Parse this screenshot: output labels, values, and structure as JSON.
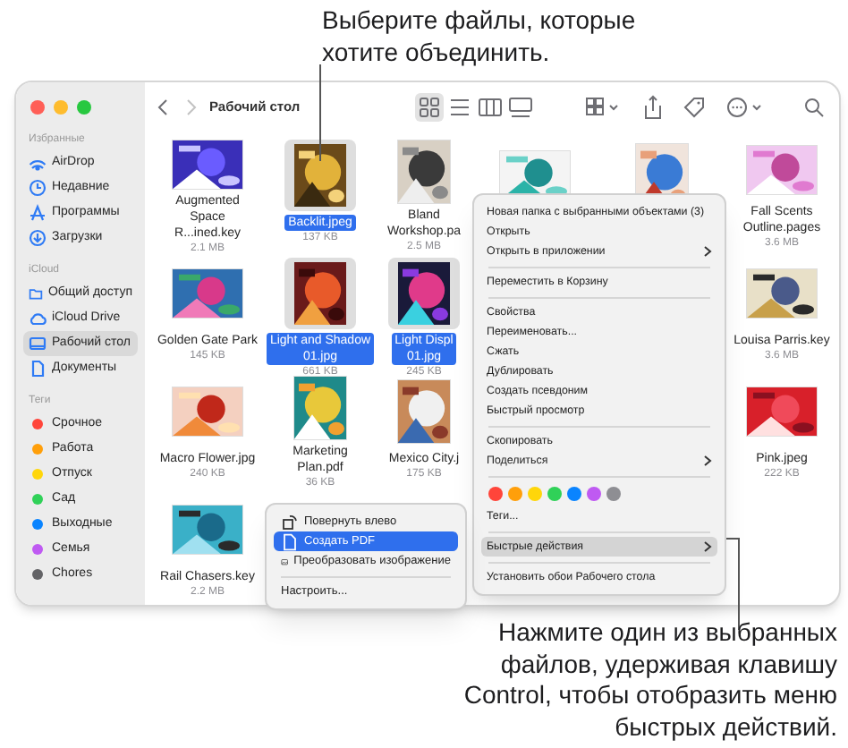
{
  "callouts": [
    {
      "text": "Выберите файлы, которые хотите объединить."
    },
    {
      "text": "Нажмите один из выбранных файлов, удерживая клавишу Control, чтобы отобразить меню быстрых действий."
    }
  ],
  "sidebar": {
    "sections": [
      {
        "header": "Избранные",
        "items": [
          {
            "kind": "airdrop",
            "label": "AirDrop",
            "selected": false
          },
          {
            "kind": "recents",
            "label": "Недавние",
            "selected": false
          },
          {
            "kind": "apps",
            "label": "Программы",
            "selected": false
          },
          {
            "kind": "downloads",
            "label": "Загрузки",
            "selected": false
          }
        ]
      },
      {
        "header": "iCloud",
        "items": [
          {
            "kind": "shared",
            "label": "Общий доступ",
            "selected": false
          },
          {
            "kind": "cloud",
            "label": "iCloud Drive",
            "selected": false
          },
          {
            "kind": "desktop",
            "label": "Рабочий стол",
            "selected": true
          },
          {
            "kind": "document",
            "label": "Документы",
            "selected": false
          }
        ]
      },
      {
        "header": "Теги",
        "items": [
          {
            "kind": "tag",
            "label": "Срочное",
            "color": "#ff453a",
            "selected": false
          },
          {
            "kind": "tag",
            "label": "Работа",
            "color": "#ff9f0a",
            "selected": false
          },
          {
            "kind": "tag",
            "label": "Отпуск",
            "color": "#ffd60a",
            "selected": false
          },
          {
            "kind": "tag",
            "label": "Сад",
            "color": "#30d158",
            "selected": false
          },
          {
            "kind": "tag",
            "label": "Выходные",
            "color": "#0a84ff",
            "selected": false
          },
          {
            "kind": "tag",
            "label": "Семья",
            "color": "#bf5af2",
            "selected": false
          },
          {
            "kind": "tag",
            "label": "Chores",
            "color": "#636366",
            "selected": false
          }
        ]
      }
    ]
  },
  "toolbar": {
    "title": "Рабочий стол",
    "views": [
      {
        "selected": true
      },
      {
        "selected": false
      },
      {
        "selected": false
      },
      {
        "selected": false
      }
    ]
  },
  "rows": [
    {
      "files": [
        {
          "name": "Augmented\nSpace R...ined.key",
          "size": "2.1 MB",
          "selected": false
        },
        {
          "name": "Backlit.jpeg",
          "size": "137 KB",
          "selected": true
        },
        {
          "name": "Bland\nWorkshop.pa",
          "size": "2.5 MB",
          "selected": false
        },
        {
          "selected": false
        },
        {
          "selected": false
        },
        {
          "name": "Fall Scents\nOutline.pages",
          "size": "3.6 MB",
          "selected": false
        }
      ]
    },
    {
      "files": [
        {
          "name": "Golden Gate Park",
          "size": "145 KB",
          "selected": false
        },
        {
          "name": "Light and Shadow\n01.jpg",
          "size": "661 KB",
          "selected": true
        },
        {
          "name": "Light Displ\n01.jpg",
          "size": "245 KB",
          "selected": true
        },
        {
          "name": "Louisa Parris.key",
          "size": "3.6 MB",
          "selected": false
        }
      ]
    },
    {
      "files": [
        {
          "name": "Macro Flower.jpg",
          "size": "240 KB",
          "selected": false
        },
        {
          "name": "Marketing\nPlan.pdf",
          "size": "36 KB",
          "selected": false
        },
        {
          "name": "Mexico City.j",
          "size": "175 KB",
          "selected": false
        },
        {
          "name": "Pink.jpeg",
          "size": "222 KB",
          "selected": false
        }
      ]
    },
    {
      "files": [
        {
          "name": "Rail Chasers.key",
          "size": "2.2 MB",
          "selected": false
        }
      ]
    }
  ],
  "context_menu": {
    "items": [
      {
        "kind": "item",
        "label": "Новая папка с выбранными объектами (3)",
        "has_submenu": false,
        "selected": false
      },
      {
        "kind": "item",
        "label": "Открыть",
        "has_submenu": false,
        "selected": false
      },
      {
        "kind": "item",
        "label": "Открыть в приложении",
        "has_submenu": true,
        "selected": false
      },
      {
        "kind": "separator"
      },
      {
        "kind": "item",
        "label": "Переместить в Корзину",
        "has_submenu": false,
        "selected": false
      },
      {
        "kind": "separator"
      },
      {
        "kind": "item",
        "label": "Свойства",
        "has_submenu": false,
        "selected": false
      },
      {
        "kind": "item",
        "label": "Переименовать...",
        "has_submenu": false,
        "selected": false
      },
      {
        "kind": "item",
        "label": "Сжать",
        "has_submenu": false,
        "selected": false
      },
      {
        "kind": "item",
        "label": "Дублировать",
        "has_submenu": false,
        "selected": false
      },
      {
        "kind": "item",
        "label": "Создать псевдоним",
        "has_submenu": false,
        "selected": false
      },
      {
        "kind": "item",
        "label": "Быстрый просмотр",
        "has_submenu": false,
        "selected": false
      },
      {
        "kind": "separator"
      },
      {
        "kind": "item",
        "label": "Скопировать",
        "has_submenu": false,
        "selected": false
      },
      {
        "kind": "item",
        "label": "Поделиться",
        "has_submenu": true,
        "selected": false
      },
      {
        "kind": "separator"
      },
      {
        "kind": "colors",
        "colors": [
          {
            "color": "#ff453a"
          },
          {
            "color": "#ff9f0a"
          },
          {
            "color": "#ffd60a"
          },
          {
            "color": "#30d158"
          },
          {
            "color": "#0a84ff"
          },
          {
            "color": "#bf5af2"
          },
          {
            "color": "#8e8e93"
          }
        ]
      },
      {
        "kind": "item",
        "label": "Теги...",
        "has_submenu": false,
        "selected": false
      },
      {
        "kind": "separator"
      },
      {
        "kind": "item",
        "label": "Быстрые действия",
        "has_submenu": true,
        "selected": true
      },
      {
        "kind": "separator"
      },
      {
        "kind": "item",
        "label": "Установить обои Рабочего стола",
        "has_submenu": false,
        "selected": false
      }
    ]
  },
  "quick_actions_menu": {
    "items": [
      {
        "kind": "action",
        "label": "Повернуть влево",
        "selected": false
      },
      {
        "kind": "action",
        "label": "Создать PDF",
        "selected": true
      },
      {
        "kind": "action",
        "label": "Преобразовать изображение",
        "selected": false
      },
      {
        "kind": "separator"
      },
      {
        "kind": "item",
        "label": "Настроить...",
        "selected": false
      }
    ]
  }
}
